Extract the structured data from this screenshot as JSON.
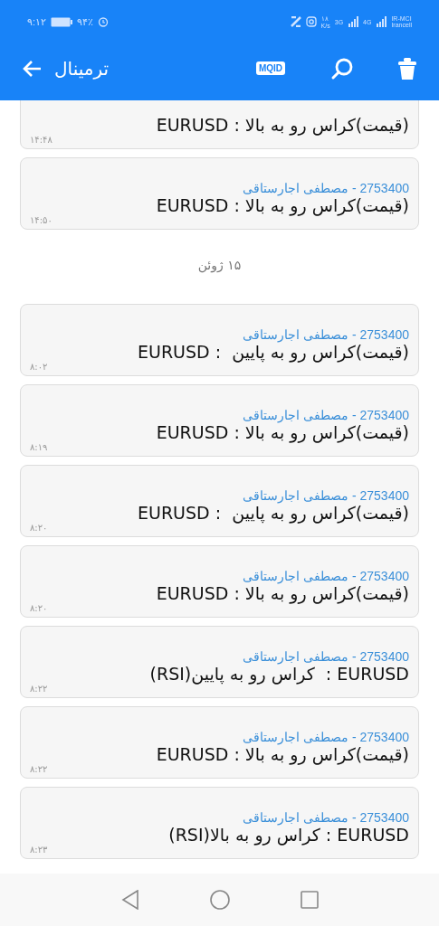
{
  "status_bar": {
    "time": "۹:۱۲",
    "battery": "۹۴٪",
    "speed": "۱۸",
    "speed_unit": "K/s",
    "network_1": "3G",
    "network_2": "4G",
    "carrier_1": "IR-MCI",
    "carrier_2": "Irancell"
  },
  "app_bar": {
    "title": "ترمینال",
    "badge": "MQID"
  },
  "messages": [
    {
      "kind": "message",
      "text": "(قیمت)کراس رو به بالا : EURUSD",
      "time": "۱۴:۴۸"
    },
    {
      "kind": "message",
      "sender": "2753400 - مصطفی اجارستاقی",
      "text": "(قیمت)کراس رو به بالا : EURUSD",
      "time": "۱۴:۵۰"
    },
    {
      "kind": "date",
      "text": "۱۵ ژوئن"
    },
    {
      "kind": "message",
      "sender": "2753400 - مصطفی اجارستاقی",
      "text": "(قیمت)کراس رو به پایین  : EURUSD",
      "time": "۸:۰۲"
    },
    {
      "kind": "message",
      "sender": "2753400 - مصطفی اجارستاقی",
      "text": "(قیمت)کراس رو به بالا : EURUSD",
      "time": "۸:۱۹"
    },
    {
      "kind": "message",
      "sender": "2753400 - مصطفی اجارستاقی",
      "text": "(قیمت)کراس رو به پایین  : EURUSD",
      "time": "۸:۲۰"
    },
    {
      "kind": "message",
      "sender": "2753400 - مصطفی اجارستاقی",
      "text": "(قیمت)کراس رو به بالا : EURUSD",
      "time": "۸:۲۰"
    },
    {
      "kind": "message",
      "sender": "2753400 - مصطفی اجارستاقی",
      "text": "EURUSD :  کراس رو به پایین(RSI)",
      "time": "۸:۲۲"
    },
    {
      "kind": "message",
      "sender": "2753400 - مصطفی اجارستاقی",
      "text": "(قیمت)کراس رو به بالا : EURUSD",
      "time": "۸:۲۲"
    },
    {
      "kind": "message",
      "sender": "2753400 - مصطفی اجارستاقی",
      "text": "EURUSD : کراس رو به بالا(RSI)",
      "time": "۸:۲۳"
    }
  ]
}
